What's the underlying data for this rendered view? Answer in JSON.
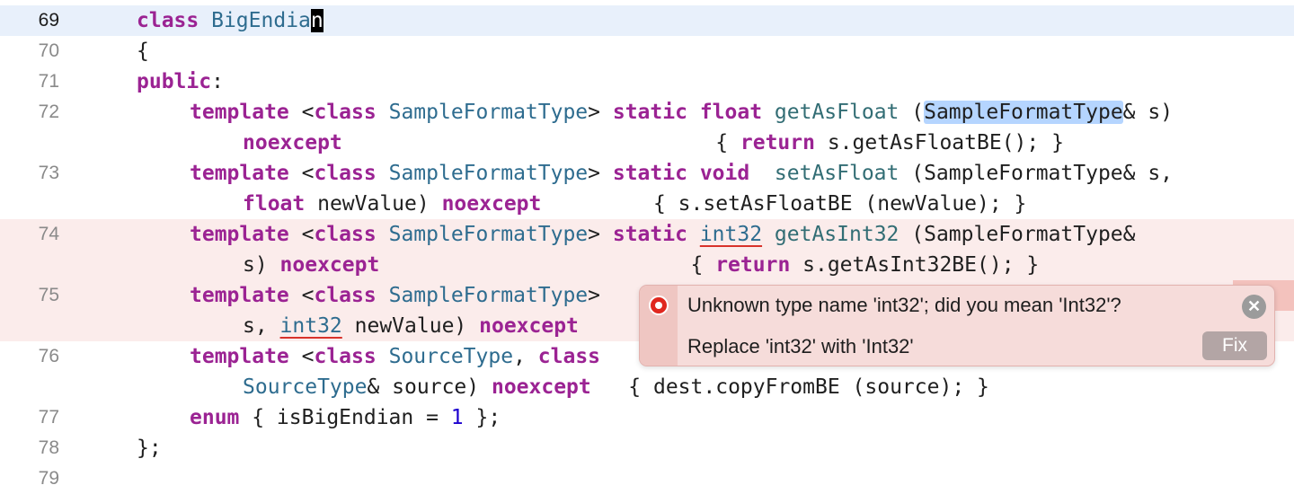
{
  "gutter": [
    "69",
    "70",
    "71",
    "72",
    "73",
    "74",
    "75",
    "76",
    "77",
    "78",
    "79"
  ],
  "code": {
    "l69": {
      "kw1": "class",
      "ty1": "BigEndia",
      "cursor": "n"
    },
    "l70": {
      "t": "{"
    },
    "l71": {
      "kw1": "public",
      "t": ":"
    },
    "l72a": {
      "kw1": "template",
      "t1": " <",
      "kw2": "class",
      "ty1": "SampleFormatType",
      "t2": "> ",
      "kw3": "static",
      "kw4": "float",
      "fn1": "getAsFloat",
      "t3": " (",
      "hl": "SampleFormatType",
      "t4": "& s)"
    },
    "l72b": {
      "kw1": "noexcept",
      "t1": "                              { ",
      "kw2": "return",
      "t2": " s.getAsFloatBE(); }"
    },
    "l73a": {
      "kw1": "template",
      "t1": " <",
      "kw2": "class",
      "ty1": "SampleFormatType",
      "t2": "> ",
      "kw3": "static",
      "kw4": "void",
      "t3": "  ",
      "fn1": "setAsFloat",
      "t4": " (SampleFormatType& s,"
    },
    "l73b": {
      "kw1": "float",
      "t1": " newValue) ",
      "kw2": "noexcept",
      "t2": "         { s.setAsFloatBE (newValue); }"
    },
    "l74a": {
      "kw1": "template",
      "t1": " <",
      "kw2": "class",
      "ty1": "SampleFormatType",
      "t2": "> ",
      "kw3": "static",
      "t3": " ",
      "err": "int32",
      "t4": " ",
      "fn1": "getAsInt32",
      "t5": " (SampleFormatType&"
    },
    "l74b": {
      "t1": "s) ",
      "kw1": "noexcept",
      "t2": "                         { ",
      "kw2": "return",
      "t3": " s.getAsInt32BE(); }"
    },
    "l75a": {
      "kw1": "template",
      "t1": " <",
      "kw2": "class",
      "ty1": "SampleFormatType",
      "t2": ">"
    },
    "l75b": {
      "t1": "s, ",
      "err": "int32",
      "t2": " newValue) ",
      "kw1": "noexcept"
    },
    "l76a": {
      "kw1": "template",
      "t1": " <",
      "kw2": "class",
      "ty1": "SourceType",
      "t2": ", ",
      "kw3": "class"
    },
    "l76b": {
      "ty1": "SourceType",
      "t1": "& source) ",
      "kw1": "noexcept",
      "t2": "   { dest.copyFromBE (source); }"
    },
    "l77": {
      "kw1": "enum",
      "t1": " { isBigEndian = ",
      "nm": "1",
      "t2": " };"
    },
    "l78": {
      "t": "};"
    }
  },
  "popup": {
    "message": "Unknown type name 'int32'; did you mean 'Int32'?",
    "fix_text": "Replace 'int32' with 'Int32'",
    "fix_label": "Fix",
    "close_glyph": "✕",
    "icon": "error-icon"
  },
  "colors": {
    "keyword": "#9b2393",
    "type": "#2e6c8f",
    "current_line": "#e8f0fb",
    "error_line": "#fbeceb",
    "error_accent": "#e0281f"
  }
}
